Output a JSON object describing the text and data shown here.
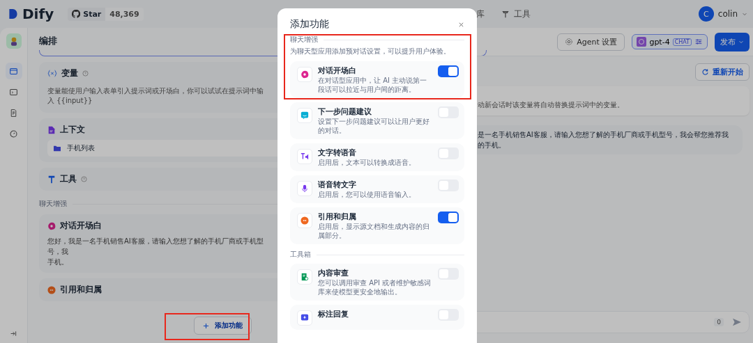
{
  "top_bar": {
    "logo": "Dify",
    "github": {
      "label": "Star",
      "count": "48,369"
    },
    "nav": [
      {
        "label": "库"
      },
      {
        "label": "工具"
      }
    ],
    "user": {
      "initial": "C",
      "name": "colin"
    }
  },
  "sidebar_items": [
    {
      "selected": true
    },
    {
      "selected": false
    },
    {
      "selected": false
    },
    {
      "selected": false
    }
  ],
  "editor": {
    "title": "编排",
    "variables": {
      "title": "变量",
      "description": "变量能使用户输入表单引入提示词或开场白，你可以试试在提示词中输入 {{input}}"
    },
    "context": {
      "title": "上下文",
      "datasets": [
        "手机列表"
      ]
    },
    "tools": {
      "title": "工具"
    },
    "section_label": "聊天增强",
    "opening": {
      "title": "对话开场白",
      "lines": [
        "您好，我是一名手机销售AI客服，请输入您想了解的手机厂商或手机型号，我",
        "手机。"
      ]
    },
    "citation": {
      "title": "引用和归属"
    },
    "add_button": "添加功能"
  },
  "toolbar": {
    "agent_settings": "Agent 设置",
    "model": {
      "name": "gpt-4",
      "badge": "CHAT"
    },
    "publish": "发布"
  },
  "debug": {
    "restart": "重新开始",
    "variable_hint": "动新会话时该变量将自动替换提示词中的变量。",
    "message_lines": [
      "是一名手机销售AI客服，请输入您想了解的手机厂商或手机型号，我会帮您推荐我",
      "的手机。"
    ],
    "counter": "0"
  },
  "modal": {
    "title": "添加功能",
    "sections": [
      {
        "label": "聊天增强",
        "description": "为聊天型应用添加预对话设置，可以提升用户体验。",
        "features": [
          {
            "title": "对话开场白",
            "description": "在对话型应用中，让 AI 主动说第一段话可以拉近与用户间的距离。",
            "on": true
          },
          {
            "title": "下一步问题建议",
            "description": "设置下一步问题建议可以让用户更好的对话。",
            "on": false
          },
          {
            "title": "文字转语音",
            "description": "启用后，文本可以转换成语音。",
            "on": false
          },
          {
            "title": "语音转文字",
            "description": "启用后，您可以使用语音输入。",
            "on": false
          },
          {
            "title": "引用和归属",
            "description": "启用后，显示源文档和生成内容的归属部分。",
            "on": true
          }
        ]
      },
      {
        "label": "工具箱",
        "features": [
          {
            "title": "内容审查",
            "description": "您可以调用审查 API 或者维护敏感词库来使模型更安全地输出。",
            "on": false
          },
          {
            "title": "标注回复",
            "on": false
          }
        ]
      }
    ]
  }
}
